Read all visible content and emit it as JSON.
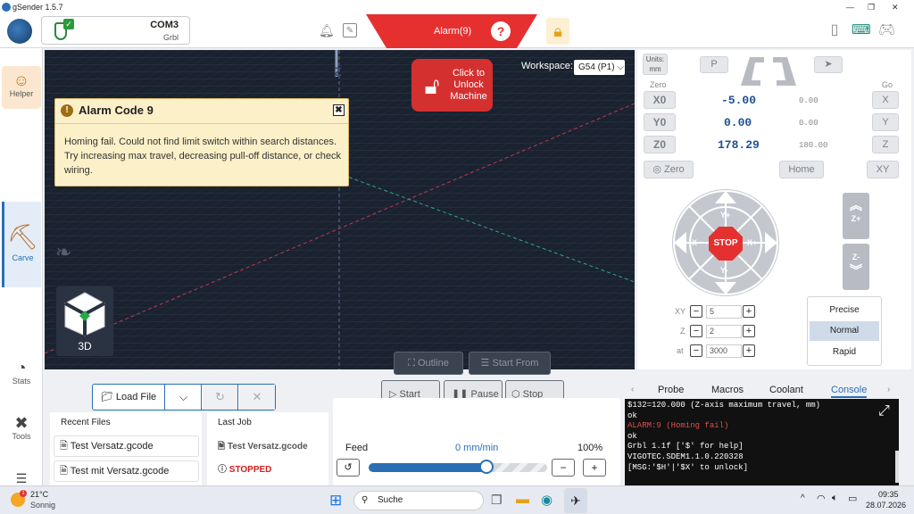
{
  "window": {
    "title": "gSender 1.5.7"
  },
  "connection": {
    "port": "COM3",
    "firmware": "Grbl"
  },
  "alarm": {
    "label": "Alarm(9)",
    "help": "?"
  },
  "sidebar": {
    "items": [
      {
        "label": "Helper"
      },
      {
        "label": "Carve"
      },
      {
        "label": "Stats"
      },
      {
        "label": "Tools"
      }
    ]
  },
  "alarm_dialog": {
    "title": "Alarm Code 9",
    "message": "Homing fail. Could not find limit switch within search distances. Try increasing max travel, decreasing pull-off distance, or check wiring.",
    "close": "✖"
  },
  "unlock": {
    "label": "Click to Unlock Machine"
  },
  "workspace": {
    "label": "Workspace:",
    "value": "G54 (P1)"
  },
  "visualizer": {
    "z_axis": "Z",
    "cube_label": "3D",
    "outline": "Outline",
    "start_from": "Start From"
  },
  "dro": {
    "units_label": "Units:",
    "units_value": "mm",
    "p_btn": "P",
    "zero_label": "Zero",
    "go_label": "Go",
    "axes": [
      {
        "axis": "X0",
        "value": "-5.00",
        "machine": "0.00",
        "go": "X"
      },
      {
        "axis": "Y0",
        "value": "0.00",
        "machine": "0.00",
        "go": "Y"
      },
      {
        "axis": "Z0",
        "value": "178.29",
        "machine": "180.00",
        "go": "Z"
      }
    ],
    "zero_btn": "Zero",
    "home_btn": "Home",
    "xy_btn": "XY"
  },
  "jog": {
    "stop": "STOP",
    "xp": "X+",
    "xm": "X-",
    "yp": "Y+",
    "ym": "Y-",
    "zp": "Z+",
    "zm": "Z-",
    "xy_label": "XY",
    "xy_val": "5",
    "z_label": "Z",
    "z_val": "2",
    "at_label": "at",
    "at_val": "3000",
    "speeds": [
      "Precise",
      "Normal",
      "Rapid"
    ],
    "selected_speed": "Normal"
  },
  "files": {
    "load_label": "Load File",
    "recent_title": "Recent Files",
    "recent": [
      "Test Versatz.gcode",
      "Test mit Versatz.gcode"
    ],
    "last_job_title": "Last Job",
    "last_job_file": "Test Versatz.gcode",
    "last_job_status": "STOPPED"
  },
  "run": {
    "start": "Start",
    "pause": "Pause",
    "stop": "Stop"
  },
  "feed": {
    "label": "Feed",
    "rate": "0 mm/min",
    "percent": "100%",
    "fraction": 0.66
  },
  "tabs": [
    "Probe",
    "Macros",
    "Coolant",
    "Console"
  ],
  "console_lines": [
    {
      "text": "$132=120.000 (Z-axis maximum travel, mm)",
      "color": "#ffffff"
    },
    {
      "text": "ok",
      "color": "#ffffff"
    },
    {
      "text": "ALARM:9 (Homing fail)",
      "color": "#e84b4b"
    },
    {
      "text": "ok",
      "color": "#ffffff"
    },
    {
      "text": "Grbl 1.1f ['$' for help]",
      "color": "#ffffff"
    },
    {
      "text": "VIGOTEC.SDEM1.1.0.220328",
      "color": "#ffffff"
    },
    {
      "text": "[MSG:'$H'|'$X' to unlock]",
      "color": "#ffffff"
    }
  ],
  "taskbar": {
    "temp": "21°C",
    "weather": "Sonnig",
    "search": "Suche",
    "time": "09:35",
    "date": "28.07.2026",
    "badge": "1"
  },
  "colors": {
    "accent": "#2a6fb5",
    "alarm": "#e63030",
    "console_bg": "#111111"
  }
}
